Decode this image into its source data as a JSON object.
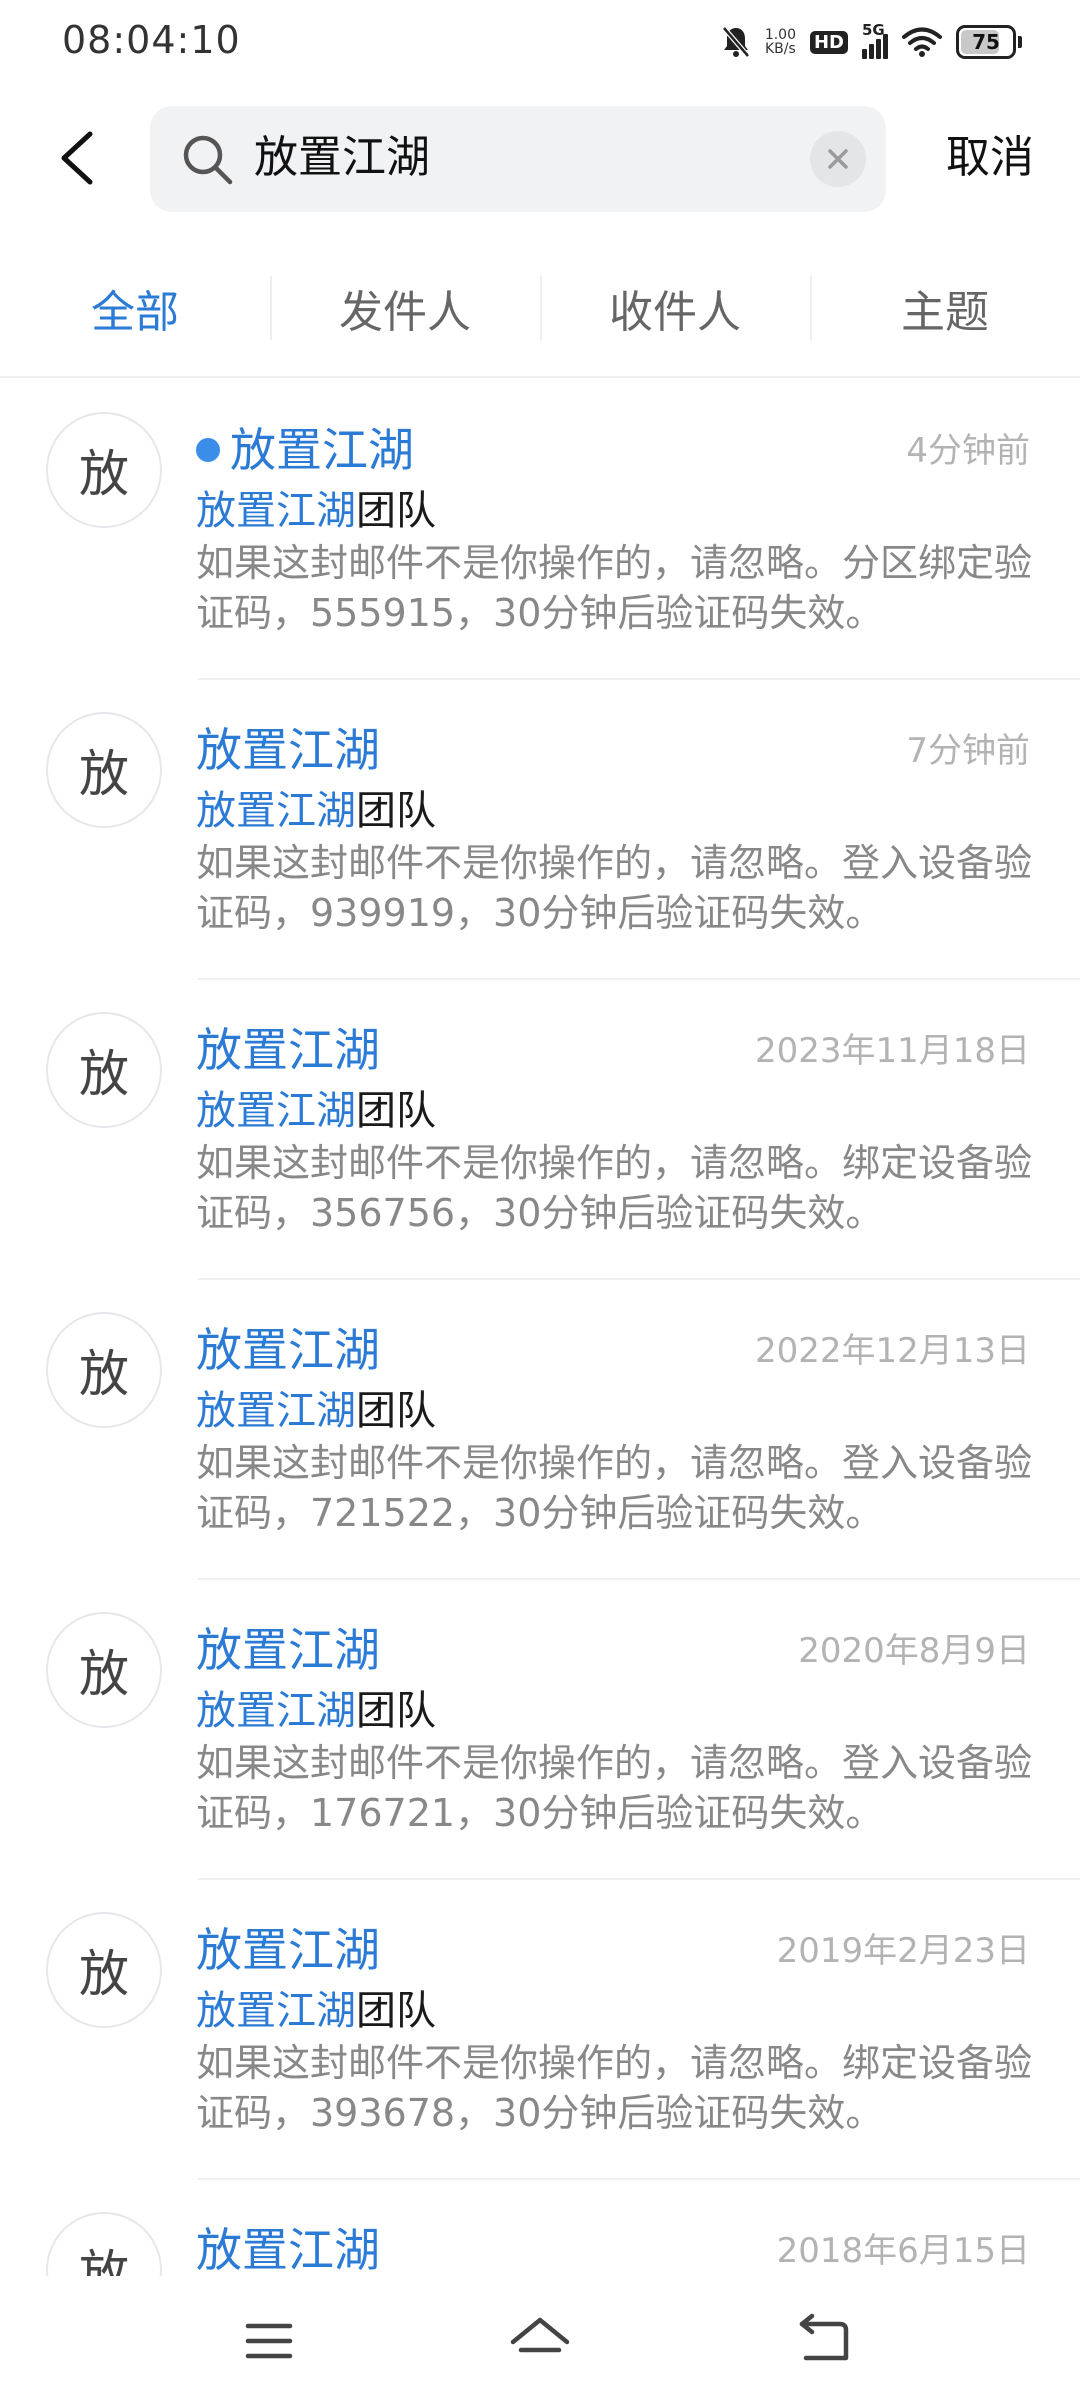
{
  "status_bar": {
    "time": "08:04:10",
    "speed_value": "1.00",
    "speed_unit": "KB/s",
    "hd": "HD",
    "network": "5G",
    "battery": "75",
    "battery_level_pct": 75
  },
  "search": {
    "query": "放置江湖",
    "cancel_label": "取消"
  },
  "tabs": [
    {
      "label": "全部",
      "active": true
    },
    {
      "label": "发件人",
      "active": false
    },
    {
      "label": "收件人",
      "active": false
    },
    {
      "label": "主题",
      "active": false
    }
  ],
  "emails": [
    {
      "avatar": "放",
      "sender": "放置江湖",
      "unread": true,
      "time": "4分钟前",
      "subject_hl": "放置江湖",
      "subject_rest": "团队",
      "preview": "如果这封邮件不是你操作的，请忽略。分区绑定验证码，555915，30分钟后验证码失效。"
    },
    {
      "avatar": "放",
      "sender": "放置江湖",
      "unread": false,
      "time": "7分钟前",
      "subject_hl": "放置江湖",
      "subject_rest": "团队",
      "preview": "如果这封邮件不是你操作的，请忽略。登入设备验证码，939919，30分钟后验证码失效。"
    },
    {
      "avatar": "放",
      "sender": "放置江湖",
      "unread": false,
      "time": "2023年11月18日",
      "subject_hl": "放置江湖",
      "subject_rest": "团队",
      "preview": "如果这封邮件不是你操作的，请忽略。绑定设备验证码，356756，30分钟后验证码失效。"
    },
    {
      "avatar": "放",
      "sender": "放置江湖",
      "unread": false,
      "time": "2022年12月13日",
      "subject_hl": "放置江湖",
      "subject_rest": "团队",
      "preview": "如果这封邮件不是你操作的，请忽略。登入设备验证码，721522，30分钟后验证码失效。"
    },
    {
      "avatar": "放",
      "sender": "放置江湖",
      "unread": false,
      "time": "2020年8月9日",
      "subject_hl": "放置江湖",
      "subject_rest": "团队",
      "preview": "如果这封邮件不是你操作的，请忽略。登入设备验证码，176721，30分钟后验证码失效。"
    },
    {
      "avatar": "放",
      "sender": "放置江湖",
      "unread": false,
      "time": "2019年2月23日",
      "subject_hl": "放置江湖",
      "subject_rest": "团队",
      "preview": "如果这封邮件不是你操作的，请忽略。绑定设备验证码，393678，30分钟后验证码失效。"
    },
    {
      "avatar": "放",
      "sender": "放置江湖",
      "unread": false,
      "time": "2018年6月15日",
      "subject_hl": "",
      "subject_rest": "",
      "preview": ""
    }
  ],
  "icons": {
    "back": "back-arrow-icon",
    "search": "search-icon",
    "clear": "clear-icon",
    "menu": "menu-icon",
    "home": "home-icon",
    "return": "return-icon"
  },
  "colors": {
    "accent": "#2b7bd6",
    "unread_dot": "#3a8ee8",
    "muted": "#888888"
  }
}
